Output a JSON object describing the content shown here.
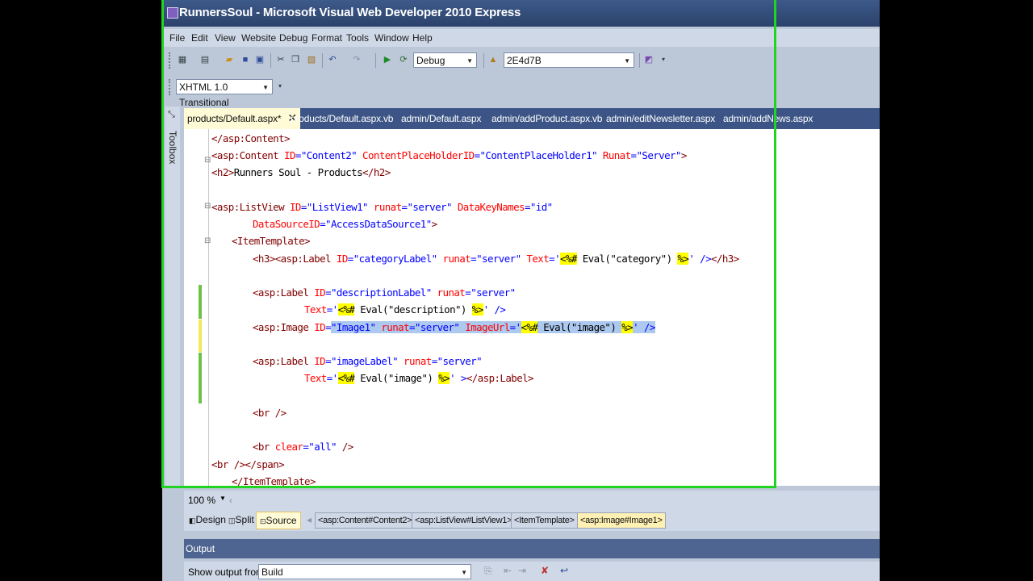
{
  "window": {
    "title": "RunnersSoul - Microsoft Visual Web Developer 2010 Express"
  },
  "menu": [
    "File",
    "Edit",
    "View",
    "Website",
    "Debug",
    "Format",
    "Tools",
    "Window",
    "Help"
  ],
  "toolbar": {
    "config_value": "Debug",
    "find_value": "2E4d7B",
    "doctype_value": "XHTML 1.0 Transitional"
  },
  "toolbox": {
    "label": "Toolbox"
  },
  "tabs": [
    {
      "label": "products/Default.aspx*",
      "active": true
    },
    {
      "label": "products/Default.aspx.vb"
    },
    {
      "label": "admin/Default.aspx"
    },
    {
      "label": "admin/addProduct.aspx.vb"
    },
    {
      "label": "admin/editNewsletter.aspx"
    },
    {
      "label": "admin/addNews.aspx"
    }
  ],
  "code": {
    "l1": {
      "a": "</asp:Content>"
    },
    "l2": {
      "a": "<asp:Content",
      "b": "ID",
      "c": "=",
      "d": "\"Content2\"",
      "e": "ContentPlaceHolderID",
      "f": "=",
      "g": "\"ContentPlaceHolder1\"",
      "h": "Runat",
      "i": "=",
      "j": "\"Server\"",
      "k": ">"
    },
    "l3": {
      "a": "<h2>",
      "b": "Runners Soul - Products",
      "c": "</h2>"
    },
    "l5": {
      "a": "<asp:ListView",
      "b": "ID",
      "c": "=",
      "d": "\"ListView1\"",
      "e": "runat",
      "f": "=",
      "g": "\"server\"",
      "h": "DataKeyNames",
      "i": "=",
      "j": "\"id\""
    },
    "l6": {
      "a": "DataSourceID",
      "b": "=",
      "c": "\"AccessDataSource1\"",
      "d": ">"
    },
    "l7": {
      "a": "<ItemTemplate>"
    },
    "l8": {
      "a": "<h3><asp:Label",
      "b": "ID",
      "c": "=",
      "d": "\"categoryLabel\"",
      "e": "runat",
      "f": "=",
      "g": "\"server\"",
      "h": "Text",
      "i": "='",
      "j": "<%#",
      "k": " Eval(\"category\") ",
      "l": "%>",
      "m": "' />",
      "n": "</h3>"
    },
    "l10": {
      "a": "<asp:Label",
      "b": "ID",
      "c": "=",
      "d": "\"descriptionLabel\"",
      "e": "runat",
      "f": "=",
      "g": "\"server\""
    },
    "l11": {
      "a": "Text",
      "b": "='",
      "c": "<%#",
      "d": " Eval(\"description\") ",
      "e": "%>",
      "f": "' />"
    },
    "l12": {
      "a": "<asp:Image",
      "b": "ID",
      "c": "=",
      "d": "\"Image1\"",
      "e": "runat",
      "f": "=",
      "g": "\"server\"",
      "h": "ImageUrl",
      "i": "='",
      "j": "<%#",
      "k": " Eval(\"image\") ",
      "l": "%>",
      "m": "' />"
    },
    "l14": {
      "a": "<asp:Label",
      "b": "ID",
      "c": "=",
      "d": "\"imageLabel\"",
      "e": "runat",
      "f": "=",
      "g": "\"server\""
    },
    "l15": {
      "a": "Text",
      "b": "='",
      "c": "<%#",
      "d": " Eval(\"image\") ",
      "e": "%>",
      "f": "' >",
      "g": "</asp:Label>"
    },
    "l17": {
      "a": "<br />"
    },
    "l19": {
      "a": "<br",
      "b": "clear",
      "c": "=",
      "d": "\"all\"",
      "e": " />"
    },
    "l20": {
      "a": "<br /></span>"
    },
    "l21": {
      "a": "</ItemTemplate>"
    }
  },
  "status": {
    "zoom": "100 %"
  },
  "views": {
    "design": "Design",
    "split": "Split",
    "source": "Source"
  },
  "breadcrumbs": [
    "<asp:Content#Content2>",
    "<asp:ListView#ListView1>",
    "<ItemTemplate>",
    "<asp:Image#Image1>"
  ],
  "output": {
    "title": "Output",
    "show_from_label": "Show output from:",
    "show_from_value": "Build"
  },
  "colors": {
    "frame": "#22d422",
    "tab_active": "#fffbd6",
    "selection": "#adc9ef",
    "title_bar": "#2b426b"
  }
}
